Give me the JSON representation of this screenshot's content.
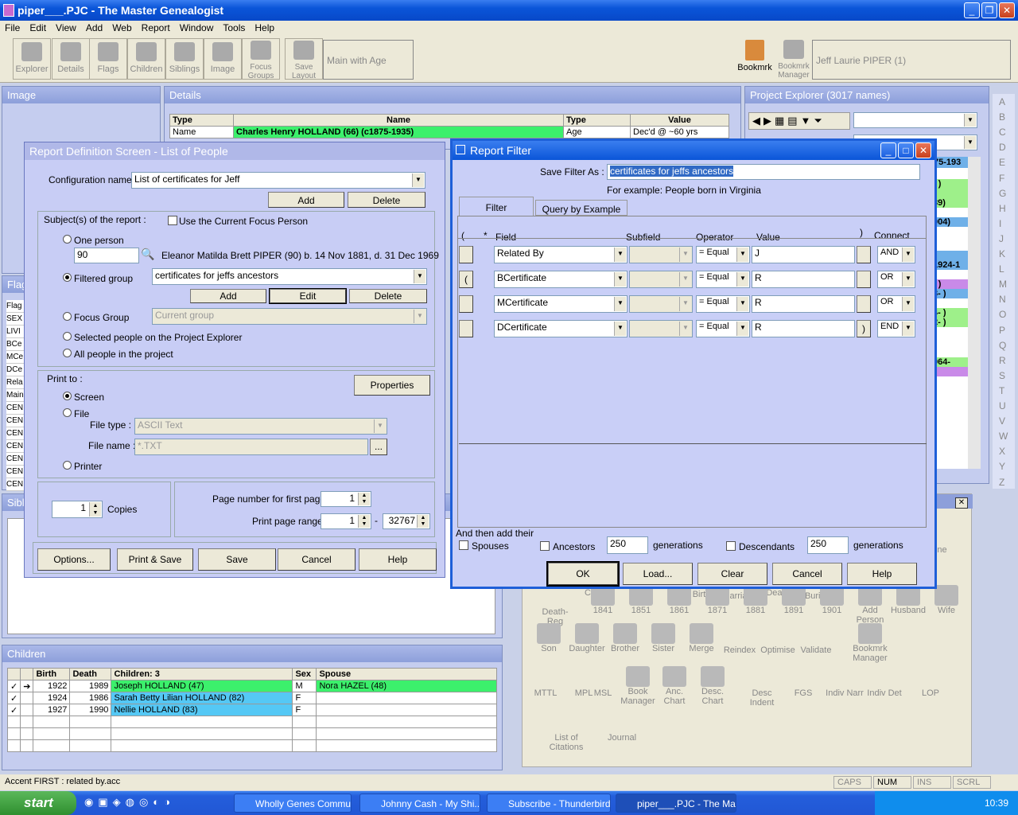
{
  "app": {
    "title": "piper___.PJC - The Master Genealogist"
  },
  "menu": [
    "File",
    "Edit",
    "View",
    "Add",
    "Web",
    "Report",
    "Window",
    "Tools",
    "Help"
  ],
  "toolbar": {
    "buttons": [
      "Explorer",
      "Details",
      "Flags",
      "Children",
      "Siblings",
      "Image",
      "Focus Groups",
      "Save Layout"
    ],
    "layout_combo": "Main with Age",
    "bookmrk": "Bookmrk",
    "bookmrk_manager": "Bookmrk Manager",
    "person_combo": "Jeff Laurie PIPER (1)"
  },
  "panels": {
    "image": "Image",
    "details": "Details",
    "project_explorer": "Project Explorer (3017 names)",
    "flags": "Flag",
    "siblings": "Sibl",
    "children": "Children"
  },
  "details_grid": {
    "headers": [
      "Type",
      "Name",
      "Type",
      "Value"
    ],
    "row": [
      "Name",
      "Charles Henry HOLLAND (66)  (c1875-1935)",
      "Age",
      "Dec'd @ ~60 yrs"
    ]
  },
  "flags_list": [
    "Flag",
    "SEX",
    "LIVI",
    "BCe",
    "MCe",
    "DCe",
    "Rela",
    "Main",
    "CEN",
    "CEN",
    "CEN",
    "CEN",
    "CEN",
    "CEN",
    "CEN"
  ],
  "alphabet": [
    "A",
    "B",
    "C",
    "D",
    "E",
    "F",
    "G",
    "H",
    "I",
    "J",
    "K",
    "L",
    "M",
    "N",
    "O",
    "P",
    "Q",
    "R",
    "S",
    "T",
    "U",
    "V",
    "W",
    "X",
    "Y",
    "Z"
  ],
  "explorer_fragments": [
    "75-193",
    "-  )",
    ")",
    "89)",
    "004)",
    ")",
    "1924-1",
    "-  )",
    "3-  )",
    "4-  )",
    "2-  )",
    "964-",
    ")"
  ],
  "children_grid": {
    "headers": [
      "",
      "",
      "Birth",
      "Death",
      "Children: 3",
      "Sex",
      "Spouse"
    ],
    "rows": [
      {
        "chk": "✓",
        "arrow": "➔",
        "birth": "1922",
        "death": "1989",
        "name": "Joseph HOLLAND (47)",
        "sex": "M",
        "spouse": "Nora HAZEL (48)"
      },
      {
        "chk": "✓",
        "arrow": "",
        "birth": "1924",
        "death": "1986",
        "name": "Sarah Betty Lilian HOLLAND (82)",
        "sex": "F",
        "spouse": ""
      },
      {
        "chk": "✓",
        "arrow": "",
        "birth": "1927",
        "death": "1990",
        "name": "Nellie HOLLAND (83)",
        "sex": "F",
        "spouse": ""
      }
    ]
  },
  "report_def": {
    "title": "Report Definition Screen - List of People",
    "config_label": "Configuration name :",
    "config_value": "List of certificates for Jeff",
    "add": "Add",
    "delete": "Delete",
    "subjects_label": "Subject(s) of the report :",
    "use_focus": "Use the Current Focus Person",
    "one_person": "One person",
    "one_person_id": "90",
    "one_person_desc": "Eleanor Matilda Brett PIPER (90) b. 14 Nov 1881, d. 31 Dec 1969",
    "filtered_group": "Filtered group",
    "filtered_value": "certificates for jeffs ancestors",
    "add2": "Add",
    "edit": "Edit",
    "delete2": "Delete",
    "focus_group": "Focus Group",
    "focus_group_value": "Current group",
    "selected_people": "Selected people on the Project Explorer",
    "all_people": "All people in the project",
    "print_to": "Print to :",
    "properties": "Properties",
    "screen": "Screen",
    "file": "File",
    "file_type_label": "File type :",
    "file_type_value": "ASCII Text",
    "file_name_label": "File name :",
    "file_name_value": "*.TXT",
    "browse": "...",
    "printer": "Printer",
    "copies_value": "1",
    "copies_label": "Copies",
    "page_first_label": "Page number for first page :",
    "page_first_value": "1",
    "page_range_label": "Print page range :",
    "page_range_from": "1",
    "page_range_dash": "-",
    "page_range_to": "32767",
    "options": "Options...",
    "print_save": "Print & Save",
    "save": "Save",
    "cancel": "Cancel",
    "help": "Help"
  },
  "filter": {
    "title": "Report Filter",
    "save_label": "Save Filter As :",
    "save_value": "certificates for jeffs ancestors",
    "example": "For example: People born in Virginia",
    "tabs": [
      "Filter",
      "Query by Example"
    ],
    "headers": {
      "paren_open": "(",
      "star": "*",
      "field": "Field",
      "subfield": "Subfield",
      "operator": "Operator",
      "value": "Value",
      "paren_close": ")",
      "connect": "Connect"
    },
    "rows": [
      {
        "open": "",
        "field": "Related By",
        "op": "=   Equal",
        "value": "J",
        "close": "",
        "connect": "AND"
      },
      {
        "open": "(",
        "field": "BCertificate",
        "op": "=   Equal",
        "value": "R",
        "close": "",
        "connect": "OR"
      },
      {
        "open": "",
        "field": "MCertificate",
        "op": "=   Equal",
        "value": "R",
        "close": "",
        "connect": "OR"
      },
      {
        "open": "",
        "field": "DCertificate",
        "op": "=   Equal",
        "value": "R",
        "close": ")",
        "connect": "END"
      }
    ],
    "then_add": "And then add their",
    "spouses": "Spouses",
    "ancestors": "Ancestors",
    "anc_gen": "250",
    "generations": "generations",
    "descendants": "Descendants",
    "desc_gen": "250",
    "generations2": "generations",
    "ok": "OK",
    "load": "Load...",
    "clear": "Clear",
    "cancel": "Cancel",
    "help": "Help"
  },
  "control_center": {
    "row0": [
      "Birth",
      "Marriage",
      "Death",
      "Burial"
    ],
    "row1": [
      "Death-Reg",
      "1841",
      "1851",
      "1861",
      "1871",
      "1881",
      "1891",
      "1901",
      "Add Person",
      "Husband",
      "Wife"
    ],
    "row2": [
      "Son",
      "Daughter",
      "Brother",
      "Sister",
      "Merge",
      "Reindex",
      "Optimise",
      "Validate",
      "Bookmrk Manager"
    ],
    "row3": [
      "MTTL",
      "MPL",
      "MSL",
      "Book Manager",
      "Anc. Chart",
      "Desc. Chart",
      "Desc Indent",
      "FGS",
      "Indiv Narr",
      "Indiv Det",
      "LOP"
    ],
    "row4": [
      "List of Citations",
      "Journal"
    ],
    "partial_top": "line",
    "partial_cals": "Cals"
  },
  "status": {
    "left": "Accent FIRST : related by.acc",
    "caps": "CAPS",
    "num": "NUM",
    "ins": "INS",
    "scrl": "SCRL"
  },
  "taskbar": {
    "start": "start",
    "tasks": [
      "Wholly Genes Commu...",
      "Johnny Cash - My Shi...",
      "Subscribe - Thunderbird",
      "piper___.PJC - The Ma..."
    ],
    "clock": "10:39"
  }
}
